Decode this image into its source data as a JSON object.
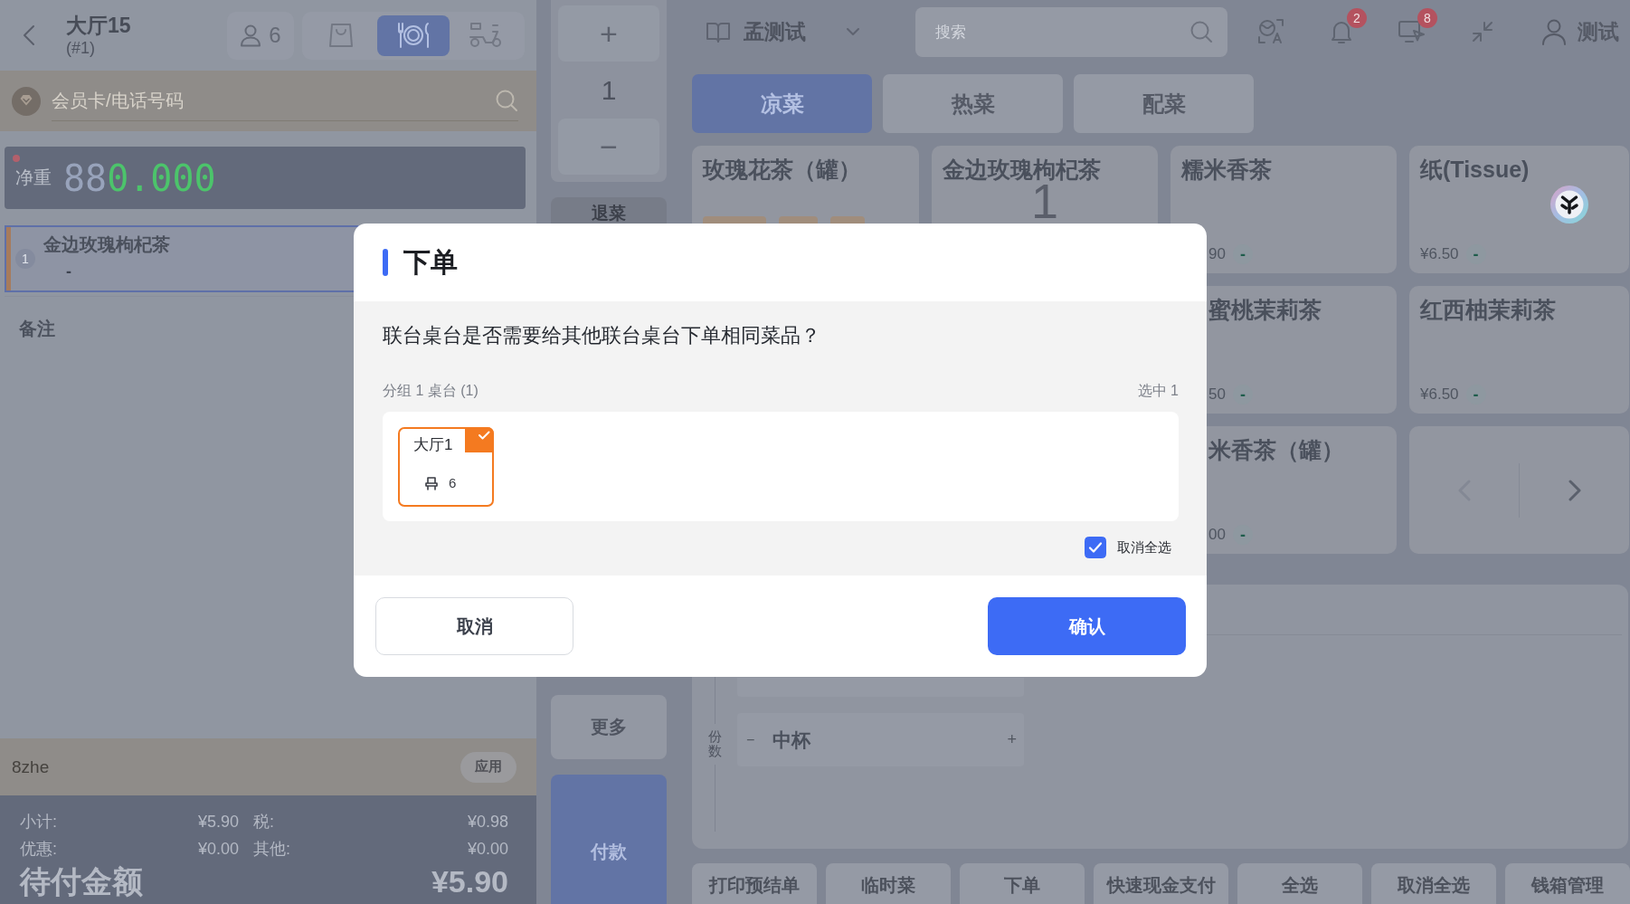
{
  "order_panel": {
    "header": {
      "title": "大厅15",
      "subtitle": "(#1)",
      "guests": "6",
      "modes": [
        {
          "kind": "takeaway",
          "selected": false
        },
        {
          "kind": "dine_in",
          "selected": true
        },
        {
          "kind": "delivery",
          "selected": false
        }
      ]
    },
    "member_search": {
      "placeholder": "会员卡/电话号码"
    },
    "scale": {
      "connected": false,
      "label": "净重",
      "unlit_digits": "88",
      "reading": "0.000"
    },
    "items": [
      {
        "index": "1",
        "name": "金边玫瑰枸杞茶",
        "detail": "-",
        "selected": true
      }
    ],
    "notes_label": "备注",
    "discount": {
      "value": "8zhe",
      "apply_label": "应用"
    },
    "totals": [
      {
        "label": "小计:",
        "value": "¥5.90"
      },
      {
        "label": "税:",
        "value": "¥0.98"
      },
      {
        "label": "优惠:",
        "value": "¥0.00"
      },
      {
        "label": "其他:",
        "value": "¥0.00"
      }
    ],
    "amount_due": {
      "label": "待付金额",
      "value": "¥5.90"
    }
  },
  "quick_actions": {
    "plus": "+",
    "quantity": "1",
    "minus": "−",
    "upper_buttons": [
      {
        "label": "退菜",
        "kind": "dark"
      }
    ],
    "lower_buttons": [
      {
        "label": "更多",
        "kind": "plain"
      },
      {
        "label": "付款",
        "kind": "primary"
      }
    ]
  },
  "top_bar": {
    "menu_name": "孟测试",
    "search_placeholder": "搜索",
    "notifications": "2",
    "print_jobs": "8",
    "user": "测试"
  },
  "categories": [
    {
      "label": "凉菜",
      "selected": true
    },
    {
      "label": "热菜",
      "selected": false
    },
    {
      "label": "配菜",
      "selected": false
    }
  ],
  "product_rows": [
    [
      {
        "kind": "product",
        "name": "玫瑰花茶（罐）",
        "tags": [
          {
            "kind": "tag"
          },
          {
            "kind": "tag"
          },
          {
            "kind": "tag"
          }
        ]
      },
      {
        "kind": "product",
        "name": "金边玫瑰枸杞茶",
        "quantity": "1"
      },
      {
        "kind": "product",
        "name": "糯米香茶",
        "price": "90",
        "price_tag": "-"
      },
      {
        "kind": "product",
        "name": "纸(Tissue)",
        "price": "¥6.50",
        "price_tag": "-"
      }
    ],
    [
      {
        "kind": "product",
        "name": "蜜桃茉莉茶",
        "price": "50",
        "price_tag": "-"
      },
      {
        "kind": "product",
        "name": "红西柚茉莉茶",
        "price": "¥6.50",
        "price_tag": "-"
      }
    ],
    [
      {
        "kind": "product",
        "name": "米香茶（罐）",
        "price": "00",
        "price_tag": "-"
      },
      {
        "kind": "pager",
        "prev": {
          "disabled": true
        },
        "next": {
          "disabled": false
        }
      }
    ]
  ],
  "spec_panel": {
    "portions_label": "份数",
    "options": [
      {
        "kind": "partial"
      },
      {
        "kind": "full",
        "minus": "−",
        "label": "中杯",
        "plus": "+"
      }
    ]
  },
  "action_bar": [
    "打印预结单",
    "临时菜",
    "下单",
    "快速现金支付",
    "全选",
    "取消全选",
    "钱箱管理"
  ],
  "dialog": {
    "title": "下单",
    "question": "联台桌台是否需要给其他联台桌台下单相同菜品？",
    "group_label": "分组 1 桌台 (1)",
    "selected_count": "选中 1",
    "tables": [
      {
        "name": "大厅1",
        "seats": "6",
        "selected": true
      }
    ],
    "select_all": {
      "label": "取消全选",
      "checked": true
    },
    "cancel": "取消",
    "confirm": "确认"
  }
}
